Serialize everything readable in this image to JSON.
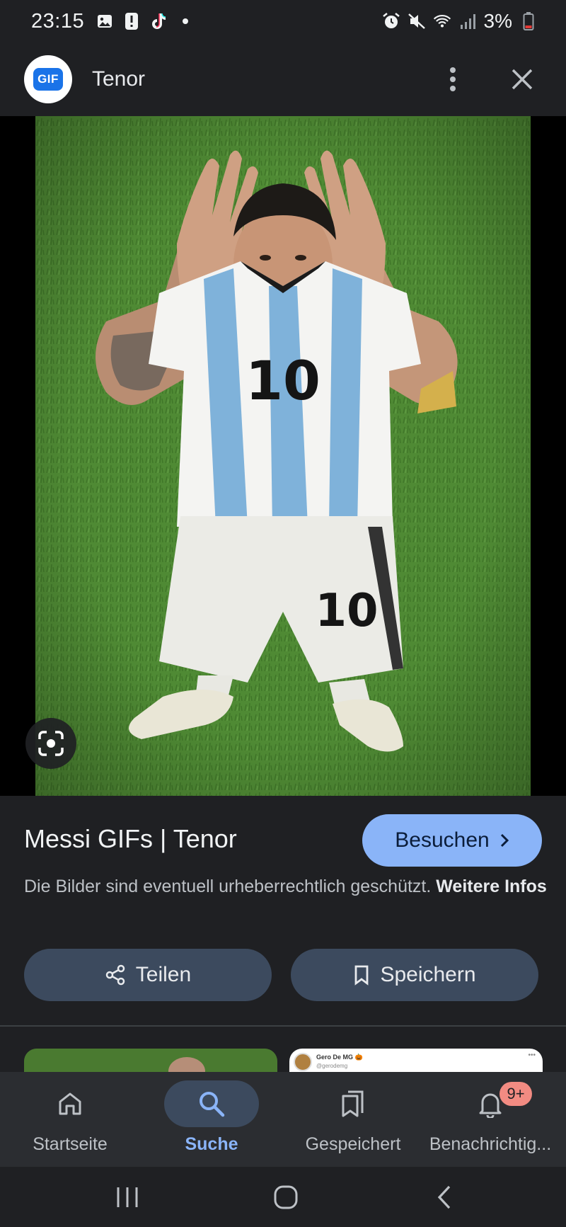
{
  "status_bar": {
    "time": "23:15",
    "battery_percent": "3%",
    "icons": [
      "gallery-icon",
      "alert-icon",
      "tiktok-icon",
      "dot-icon",
      "alarm-icon",
      "mute-icon",
      "wifi-icon",
      "signal-icon",
      "battery-low-icon"
    ]
  },
  "header": {
    "logo_text": "GIF",
    "title": "Tenor",
    "icons": [
      "more-vert-icon",
      "close-icon"
    ]
  },
  "image": {
    "jersey_number": "10"
  },
  "info": {
    "title": "Messi GIFs | Tenor",
    "visit_label": "Besuchen",
    "copyright_text": "Die Bilder sind eventuell urheberrechtlich geschützt.",
    "more_info_label": "Weitere Infos",
    "share_label": "Teilen",
    "save_label": "Speichern"
  },
  "thumb_tweet": {
    "name": "Gero De MG 🎃",
    "handle": "@gerodemg"
  },
  "bottom_nav": {
    "items": [
      {
        "label": "Startseite",
        "icon": "home-icon"
      },
      {
        "label": "Suche",
        "icon": "search-icon",
        "active": true
      },
      {
        "label": "Gespeichert",
        "icon": "collections-icon"
      },
      {
        "label": "Benachrichtig...",
        "icon": "bell-icon",
        "badge": "9+"
      }
    ]
  },
  "colors": {
    "background": "#1f2023",
    "accent": "#8ab4f8",
    "chip": "#3c4a5e",
    "badge": "#f28b82"
  }
}
